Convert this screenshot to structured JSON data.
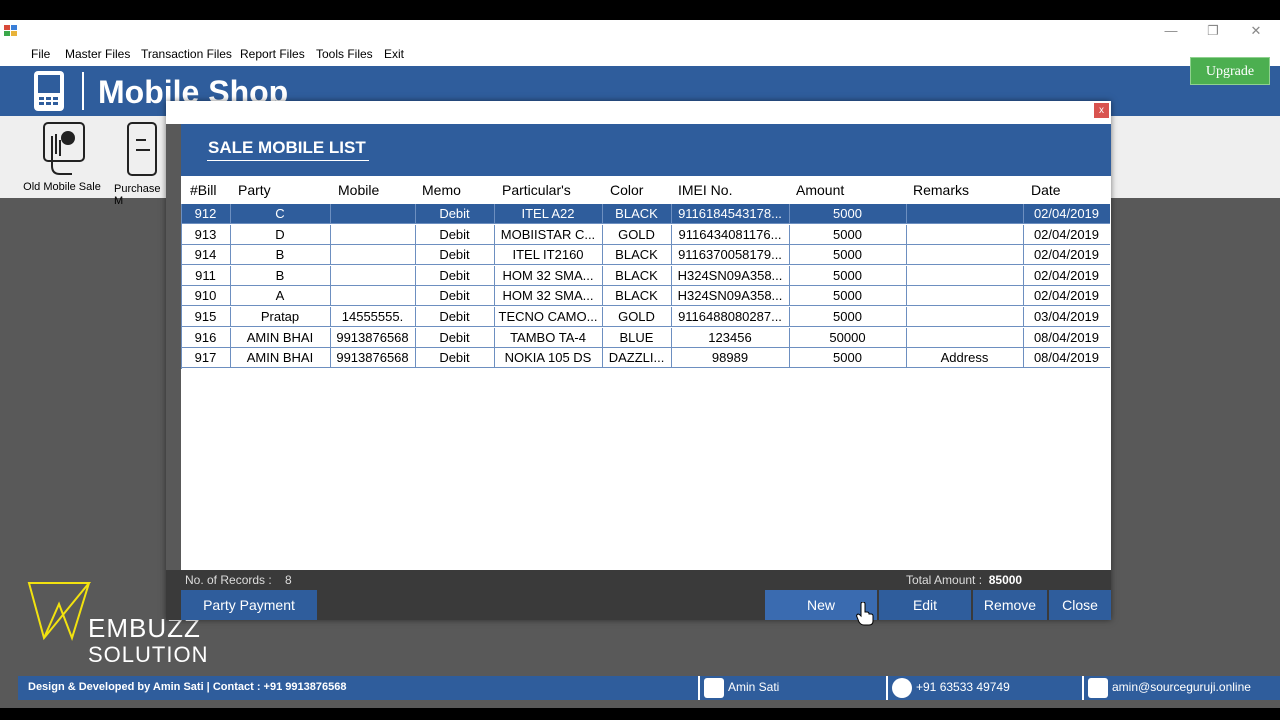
{
  "window": {
    "controls": {
      "minimize": "—",
      "restore": "❐",
      "close": "✕"
    }
  },
  "menu": [
    "File",
    "Master Files",
    "Transaction Files",
    "Report Files",
    "Tools Files",
    "Exit"
  ],
  "header": {
    "title": "Mobile Shop",
    "upgrade_label": "Upgrade"
  },
  "tools": [
    {
      "label": "Old Mobile Sale",
      "icon": "hand-phone-icon"
    },
    {
      "label": "Purchase M",
      "icon": "phone-hand-icon"
    }
  ],
  "dialog": {
    "title": "SALE MOBILE LIST",
    "close_label": "x",
    "columns": [
      "#Bill",
      "Party",
      "Mobile",
      "Memo",
      "Particular's",
      "Color",
      "IMEI No.",
      "Amount",
      "Remarks",
      "Date"
    ],
    "rows": [
      [
        "912",
        "C",
        "",
        "Debit",
        "ITEL A22",
        "BLACK",
        "9116184543178...",
        "5000",
        "",
        "02/04/2019"
      ],
      [
        "913",
        "D",
        "",
        "Debit",
        "MOBIISTAR C...",
        "GOLD",
        "9116434081176...",
        "5000",
        "",
        "02/04/2019"
      ],
      [
        "914",
        "B",
        "",
        "Debit",
        "ITEL  IT2160",
        "BLACK",
        "9116370058179...",
        "5000",
        "",
        "02/04/2019"
      ],
      [
        "911",
        "B",
        "",
        "Debit",
        "HOM  32 SMA...",
        "BLACK",
        "H324SN09A358...",
        "5000",
        "",
        "02/04/2019"
      ],
      [
        "910",
        "A",
        "",
        "Debit",
        "HOM  32 SMA...",
        "BLACK",
        "H324SN09A358...",
        "5000",
        "",
        "02/04/2019"
      ],
      [
        "915",
        "Pratap",
        "14555555.",
        "Debit",
        "TECNO CAMO...",
        "GOLD",
        "9116488080287...",
        "5000",
        "",
        "03/04/2019"
      ],
      [
        "916",
        "AMIN BHAI",
        "9913876568",
        "Debit",
        "TAMBO TA-4",
        "BLUE",
        "123456",
        "50000",
        "",
        "08/04/2019"
      ],
      [
        "917",
        "AMIN BHAI",
        "9913876568",
        "Debit",
        "NOKIA 105 DS",
        "DAZZLI...",
        "98989",
        "5000",
        "Address",
        "08/04/2019"
      ]
    ],
    "selected_row": 0,
    "records_label": "No. of Records :",
    "records_value": "8",
    "total_label": "Total Amount :",
    "total_value": "85000",
    "buttons": {
      "party_payment": "Party Payment",
      "new": "New",
      "edit": "Edit",
      "remove": "Remove",
      "close": "Close"
    }
  },
  "brand": {
    "line1": "EMBUZZ",
    "line2": "SOLUTION"
  },
  "status": {
    "credit": "Design & Developed by Amin Sati | Contact : +91 9913876568",
    "user": "Amin Sati",
    "phone": "+91 63533 49749",
    "email": "amin@sourceguruji.online"
  },
  "colors": {
    "accent": "#2f5d9c",
    "upgrade": "#4caf50",
    "brand_yellow": "#f2e20f"
  }
}
